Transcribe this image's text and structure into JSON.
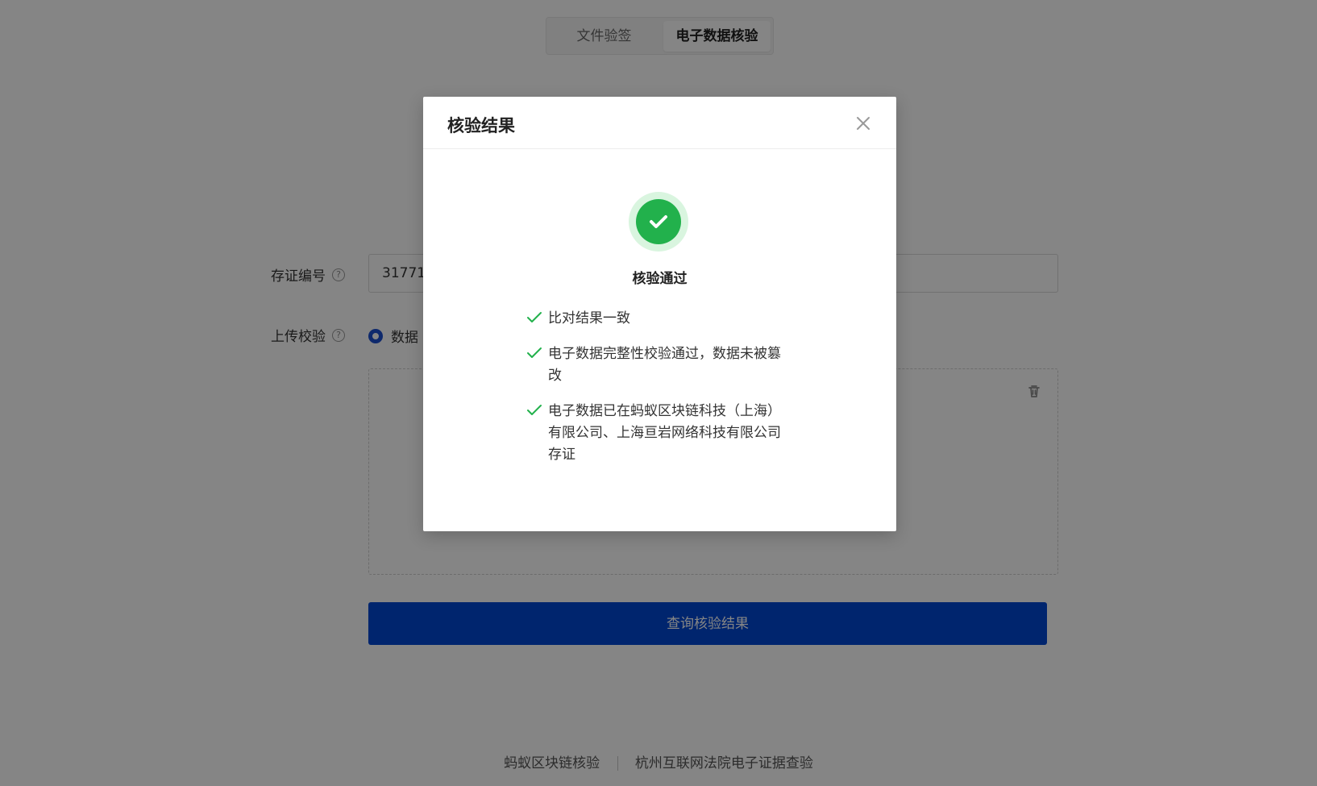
{
  "tabs": [
    {
      "label": "文件验签",
      "active": false
    },
    {
      "label": "电子数据核验",
      "active": true
    }
  ],
  "form": {
    "cert_label": "存证编号",
    "cert_value": "31771",
    "upload_label": "上传校验",
    "upload_option_label": "数据",
    "help_icon": "?",
    "submit_label": "查询核验结果"
  },
  "footer": {
    "left_link": "蚂蚁区块链核验",
    "right_link": "杭州互联网法院电子证据查验"
  },
  "modal": {
    "title": "核验结果",
    "status_text": "核验通过",
    "results": [
      "比对结果一致",
      "电子数据完整性校验通过，数据未被篡改",
      "电子数据已在蚂蚁区块链科技（上海）有限公司、上海亘岩网络科技有限公司存证"
    ]
  },
  "colors": {
    "primary": "#0047d4",
    "success": "#22b14c",
    "success_bg": "#d9f5df"
  },
  "icons": [
    "help-icon",
    "trash-icon",
    "close-icon",
    "check-circle-icon",
    "check-icon"
  ]
}
